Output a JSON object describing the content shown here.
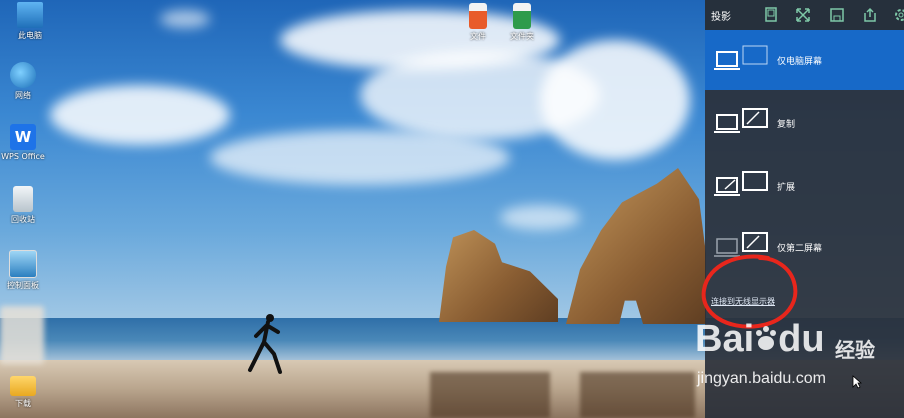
{
  "desktop": {
    "icons": [
      {
        "label": "此电脑",
        "icon": "computer-icon"
      },
      {
        "label": "网络",
        "icon": "network-globe-icon"
      },
      {
        "label": "WPS Office",
        "icon": "wps-office-icon"
      },
      {
        "label": "回收站",
        "icon": "recycle-bin-icon"
      },
      {
        "label": "控制面板",
        "icon": "control-panel-icon"
      },
      {
        "label": "",
        "icon": "blurred-file-icon"
      },
      {
        "label": "下载",
        "icon": "downloads-folder-icon"
      }
    ],
    "top_files": [
      {
        "label": "文件",
        "icon": "ppt-file-icon"
      },
      {
        "label": "文件夹",
        "icon": "xls-file-icon"
      }
    ]
  },
  "project_panel": {
    "title": "投影",
    "toolbar_icons": [
      "screen-icon",
      "fullscreen-icon",
      "save-icon",
      "share-icon",
      "settings-icon"
    ],
    "options": [
      {
        "label": "仅电脑屏幕",
        "selected": true
      },
      {
        "label": "复制",
        "selected": false
      },
      {
        "label": "扩展",
        "selected": false
      },
      {
        "label": "仅第二屏幕",
        "selected": false
      }
    ],
    "wireless_link": "连接到无线显示器"
  },
  "watermark": {
    "brand": "Bai",
    "brand_suffix": "du",
    "product": "经验",
    "url": "jingyan.baidu.com"
  },
  "colors": {
    "panel_bg": "#2a303a",
    "selected": "#1769c8",
    "annotation": "#e8261c"
  }
}
